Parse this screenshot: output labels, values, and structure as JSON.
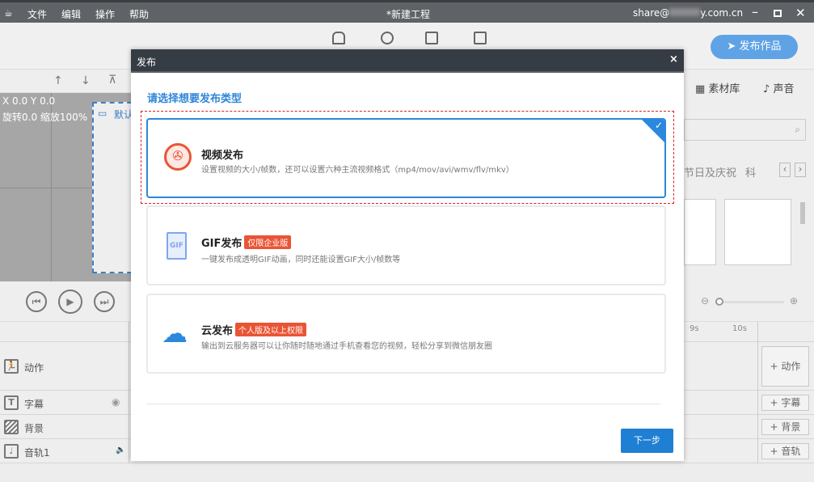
{
  "titlebar": {
    "menu": [
      "文件",
      "编辑",
      "操作",
      "帮助"
    ],
    "title": "*新建工程",
    "account": "share@",
    "account_suffix": "y.com.cn"
  },
  "toolbar": {
    "publish_label": "发布作品"
  },
  "canvas": {
    "position": "X 0.0 Y 0.0",
    "transform": "旋转0.0 缩放100%",
    "stage_label": "默认"
  },
  "right_panel": {
    "tabs": [
      "素材库",
      "声音"
    ],
    "categories": [
      "节日及庆祝",
      "科"
    ]
  },
  "timeline": {
    "ruler": [
      "9s",
      "10s"
    ],
    "tracks": [
      {
        "label": "动作",
        "add": "动作"
      },
      {
        "label": "字幕",
        "add": "字幕"
      },
      {
        "label": "背景",
        "add": "背景"
      },
      {
        "label": "音轨1",
        "add": "音轨"
      }
    ]
  },
  "dialog": {
    "title": "发布",
    "close": "×",
    "heading": "请选择想要发布类型",
    "options": [
      {
        "title": "视频发布",
        "badge": "",
        "desc": "设置视频的大小/帧数，还可以设置六种主流视频格式（mp4/mov/avi/wmv/flv/mkv）",
        "selected": true
      },
      {
        "title": "GIF发布",
        "badge": "仅限企业版",
        "desc": "一键发布成透明GIF动画，同时还能设置GIF大小/帧数等",
        "icon_text": "GIF"
      },
      {
        "title": "云发布",
        "badge": "个人版及以上权限",
        "desc": "输出到云服务器可以让你随时随地通过手机查看您的视频，轻松分享到微信朋友圈"
      }
    ],
    "next_label": "下一步"
  },
  "colors": {
    "accent": "#1f7fd3",
    "badge": "#ea5435",
    "dialog_header": "#363c44"
  }
}
